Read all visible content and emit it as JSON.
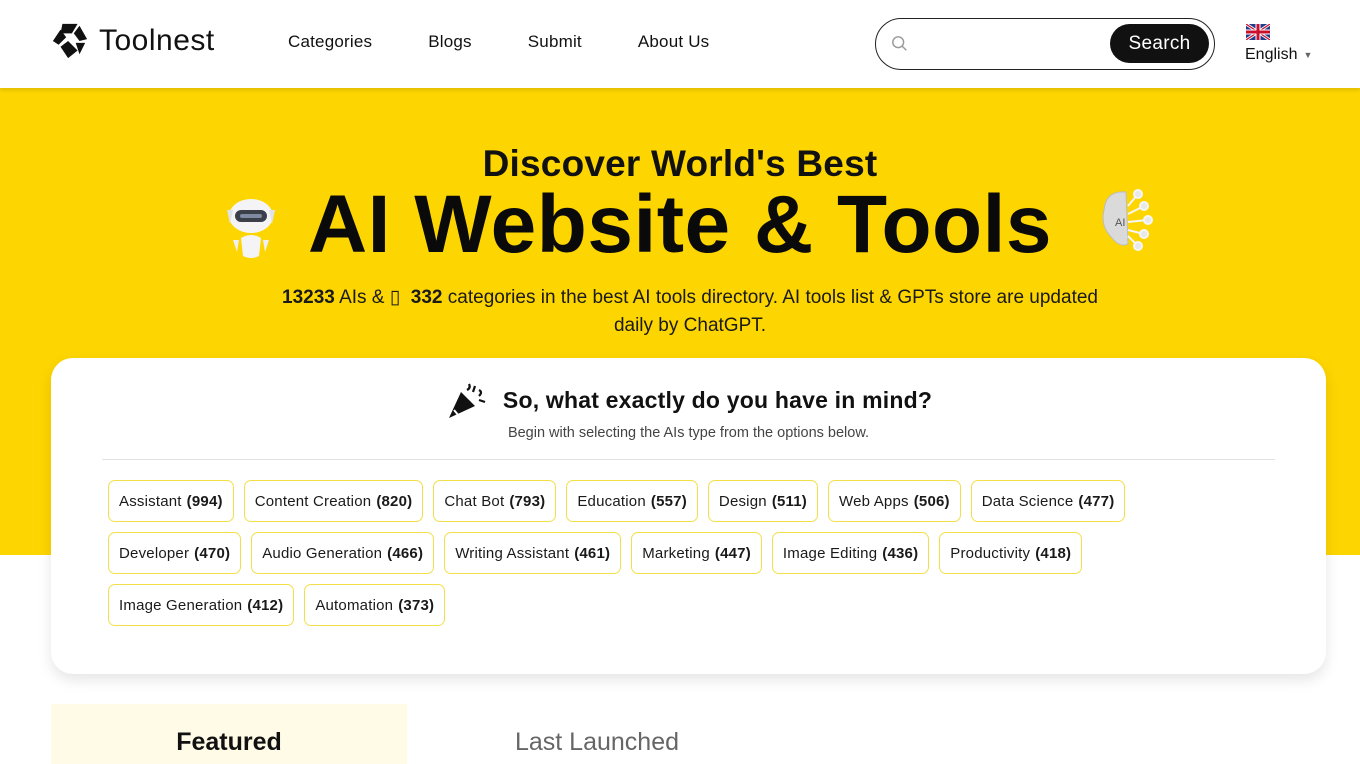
{
  "header": {
    "logo_text": "Toolnest",
    "nav": [
      "Categories",
      "Blogs",
      "Submit",
      "About Us"
    ],
    "search": {
      "placeholder": "",
      "value": "",
      "button_label": "Search"
    },
    "language": {
      "label": "English",
      "flag": "uk-flag-icon"
    }
  },
  "hero": {
    "subtitle": "Discover World's Best",
    "title": "AI Website & Tools",
    "ai_count": "13233",
    "ai_label": " AIs & ",
    "cat_count": "332",
    "desc_rest": " categories in the best AI tools directory. AI tools list & GPTs store are updated daily by ChatGPT."
  },
  "card": {
    "title": "So, what exactly do you have in mind?",
    "subtitle": "Begin with selecting the AIs type from the options below.",
    "categories": [
      {
        "name": "Assistant",
        "count": "(994)"
      },
      {
        "name": "Content Creation",
        "count": "(820)"
      },
      {
        "name": "Chat Bot",
        "count": "(793)"
      },
      {
        "name": "Education",
        "count": "(557)"
      },
      {
        "name": "Design",
        "count": "(511)"
      },
      {
        "name": "Web Apps",
        "count": "(506)"
      },
      {
        "name": "Data Science",
        "count": "(477)"
      },
      {
        "name": "Developer",
        "count": "(470)"
      },
      {
        "name": "Audio Generation",
        "count": "(466)"
      },
      {
        "name": "Writing Assistant",
        "count": "(461)"
      },
      {
        "name": "Marketing",
        "count": "(447)"
      },
      {
        "name": "Image Editing",
        "count": "(436)"
      },
      {
        "name": "Productivity",
        "count": "(418)"
      },
      {
        "name": "Image Generation",
        "count": "(412)"
      },
      {
        "name": "Automation",
        "count": "(373)"
      }
    ]
  },
  "tabs": {
    "featured": "Featured",
    "last_launched": "Last Launched"
  },
  "colors": {
    "accent": "#fdd500",
    "chip_border": "#f3df4a",
    "tab_active_bg": "#fffbe6"
  }
}
